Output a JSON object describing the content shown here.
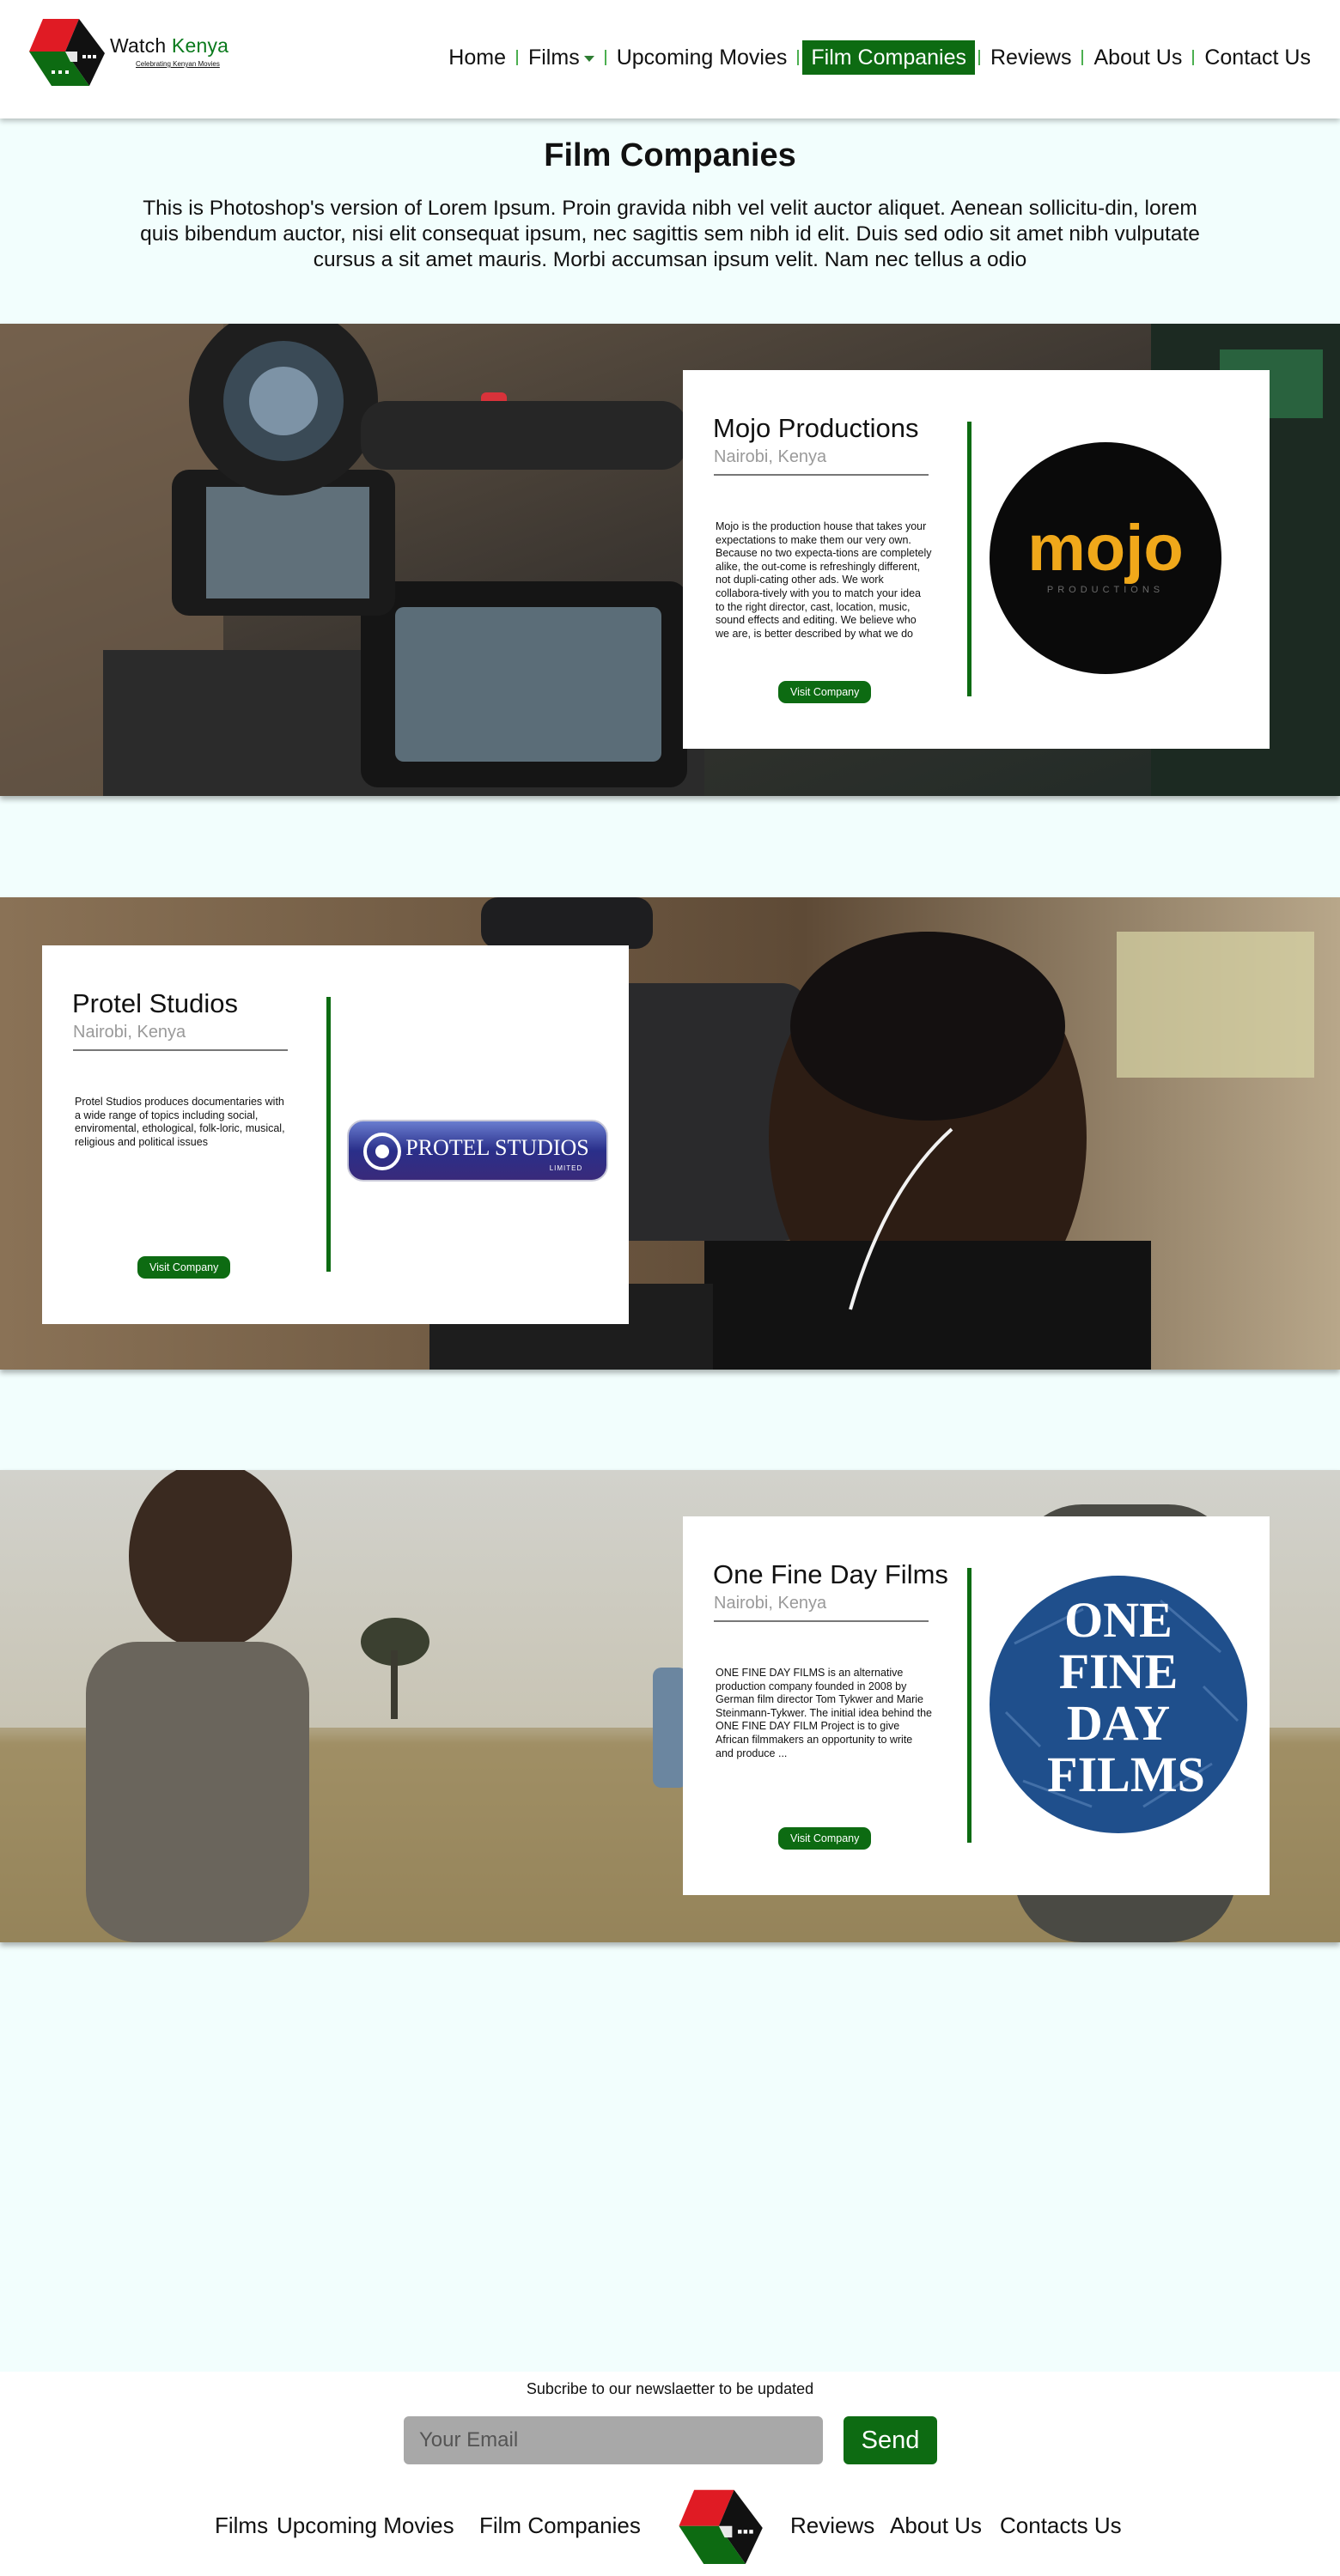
{
  "brand": {
    "name_part1": "Watch ",
    "name_part2": "Kenya",
    "tagline": "Celebrating Kenyan Movies",
    "colors": {
      "green": "#0d6b12",
      "red": "#e01b24",
      "black": "#111111"
    }
  },
  "nav": {
    "items": [
      {
        "label": "Home"
      },
      {
        "label": "Films"
      },
      {
        "label": "Upcoming Movies"
      },
      {
        "label": "Film Companies"
      },
      {
        "label": "Reviews"
      },
      {
        "label": "About Us"
      },
      {
        "label": "Contact Us"
      }
    ],
    "active": "Film Companies"
  },
  "page": {
    "title": "Film Companies",
    "intro": "This is Photoshop's version  of Lorem Ipsum. Proin gravida nibh vel velit auctor aliquet. Aenean sollicitu-din, lorem quis bibendum auctor, nisi elit consequat ipsum, nec sagittis sem nibh id elit. Duis sed odio sit amet nibh vulputate cursus a sit amet mauris. Morbi accumsan ipsum velit. Nam nec tellus a odio"
  },
  "companies": [
    {
      "name": "Mojo Productions",
      "location": "Nairobi, Kenya",
      "description": "Mojo is the production house that takes your expectations to make them our very own. Because no two expecta-tions are completely alike, the out-come is refreshingly different, not dupli-cating other ads. We work collabora-tively with you to match your idea to the right director, cast, location, music, sound effects and editing. We believe who we are, is better described by what we do",
      "button": "Visit Company",
      "logo_text": "mojo",
      "logo_sub": "PRODUCTIONS"
    },
    {
      "name": "Protel Studios",
      "location": "Nairobi, Kenya",
      "description": "Protel Studios produces documentaries with a wide range of topics including social, enviromental, ethological, folk-loric, musical, religious and political issues",
      "button": "Visit Company",
      "logo_text": "PROTEL STUDIOS",
      "logo_sub": "LIMITED"
    },
    {
      "name": "One Fine Day Films",
      "location": "Nairobi, Kenya",
      "description": "ONE FINE DAY FILMS is an alternative production company founded in 2008 by German film director Tom Tykwer and Marie Steinmann-Tykwer. The initial idea behind the ONE FINE DAY FILM Project is to give African filmmakers an opportunity to write and produce  ...",
      "button": "Visit Company",
      "logo_lines": [
        "ONE",
        "FINE",
        "DAY",
        "FILMS"
      ]
    }
  ],
  "footer": {
    "newsletter_label": "Subcribe to our newslaetter to be updated",
    "email_placeholder": "Your Email",
    "send_label": "Send",
    "links_left": [
      "Films",
      "Upcoming Movies",
      "Film Companies"
    ],
    "links_right": [
      "Reviews",
      "About Us",
      "Contacts Us"
    ]
  }
}
